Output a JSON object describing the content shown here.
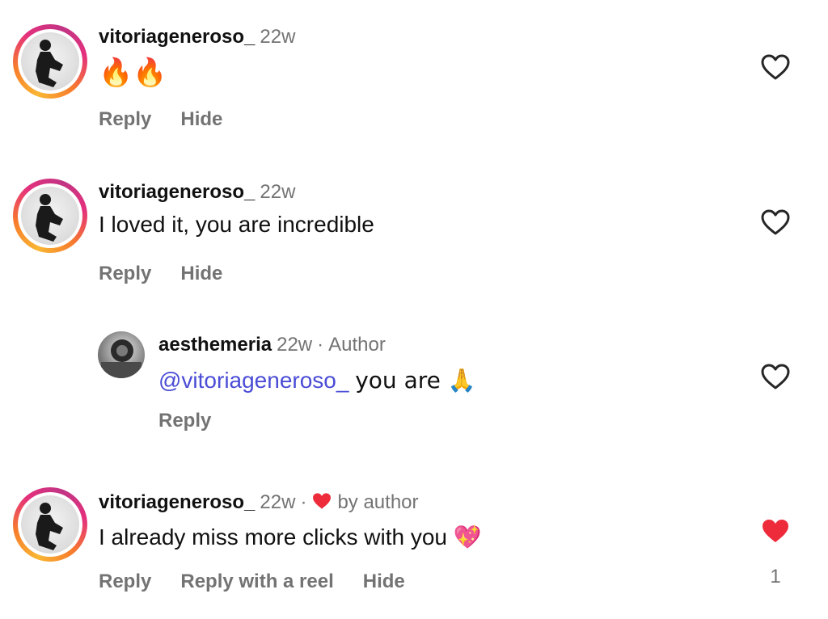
{
  "comments": [
    {
      "username": "vitoriageneroso_",
      "time": "22w",
      "text": "🔥🔥",
      "actions": [
        "Reply",
        "Hide"
      ],
      "liked": false
    },
    {
      "username": "vitoriageneroso_",
      "time": "22w",
      "text": "I loved it, you are incredible",
      "actions": [
        "Reply",
        "Hide"
      ],
      "liked": false
    },
    {
      "username": "aesthemeria",
      "time": "22w",
      "badge": "Author",
      "mention": "@vitoriageneroso_",
      "text": "you are 🙏",
      "actions": [
        "Reply"
      ],
      "liked": false
    },
    {
      "username": "vitoriageneroso_",
      "time": "22w",
      "liked_by": "by author",
      "text": "I already miss more clicks with you 💖",
      "actions": [
        "Reply",
        "Reply with a reel",
        "Hide"
      ],
      "liked": true,
      "like_count": "1"
    }
  ],
  "colors": {
    "heart_liked": "#ed2b3a",
    "mention": "#4a4cd6",
    "muted": "#737373"
  },
  "icons": {
    "like": "heart-outline-icon",
    "liked": "heart-filled-icon"
  }
}
